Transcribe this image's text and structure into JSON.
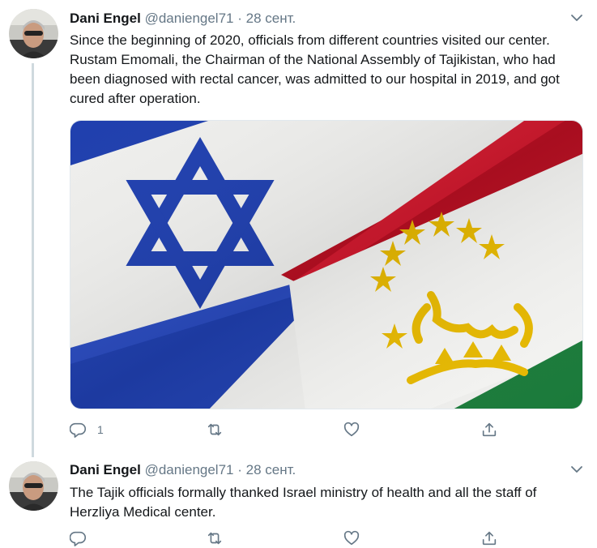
{
  "tweets": [
    {
      "author_name": "Dani Engel",
      "handle": "@daniengel71",
      "separator": "·",
      "date": "28 сент.",
      "text": "Since the beginning of 2020, officials from different countries visited our center. Rustam Emomali, the Chairman of the National Assembly of Tajikistan, who had been diagnosed with rectal cancer, was admitted to our hospital in 2019, and got cured after operation.",
      "media": {
        "description_icon": "israel-tajikistan-flags"
      },
      "reply_count": "1"
    },
    {
      "author_name": "Dani Engel",
      "handle": "@daniengel71",
      "separator": "·",
      "date": "28 сент.",
      "text": "The Tajik officials formally thanked Israel ministry of health and all the staff of Herzliya Medical center."
    }
  ],
  "colors": {
    "text": "#14171a",
    "secondary": "#657786",
    "thread_line": "#cfd9de",
    "israel_blue": "#1f3fae",
    "tajik_red": "#c8102e",
    "tajik_green": "#1a7a3a",
    "tajik_gold": "#e6b800"
  },
  "icons": [
    "chevron-down-icon",
    "reply-icon",
    "retweet-icon",
    "like-icon",
    "share-icon"
  ]
}
